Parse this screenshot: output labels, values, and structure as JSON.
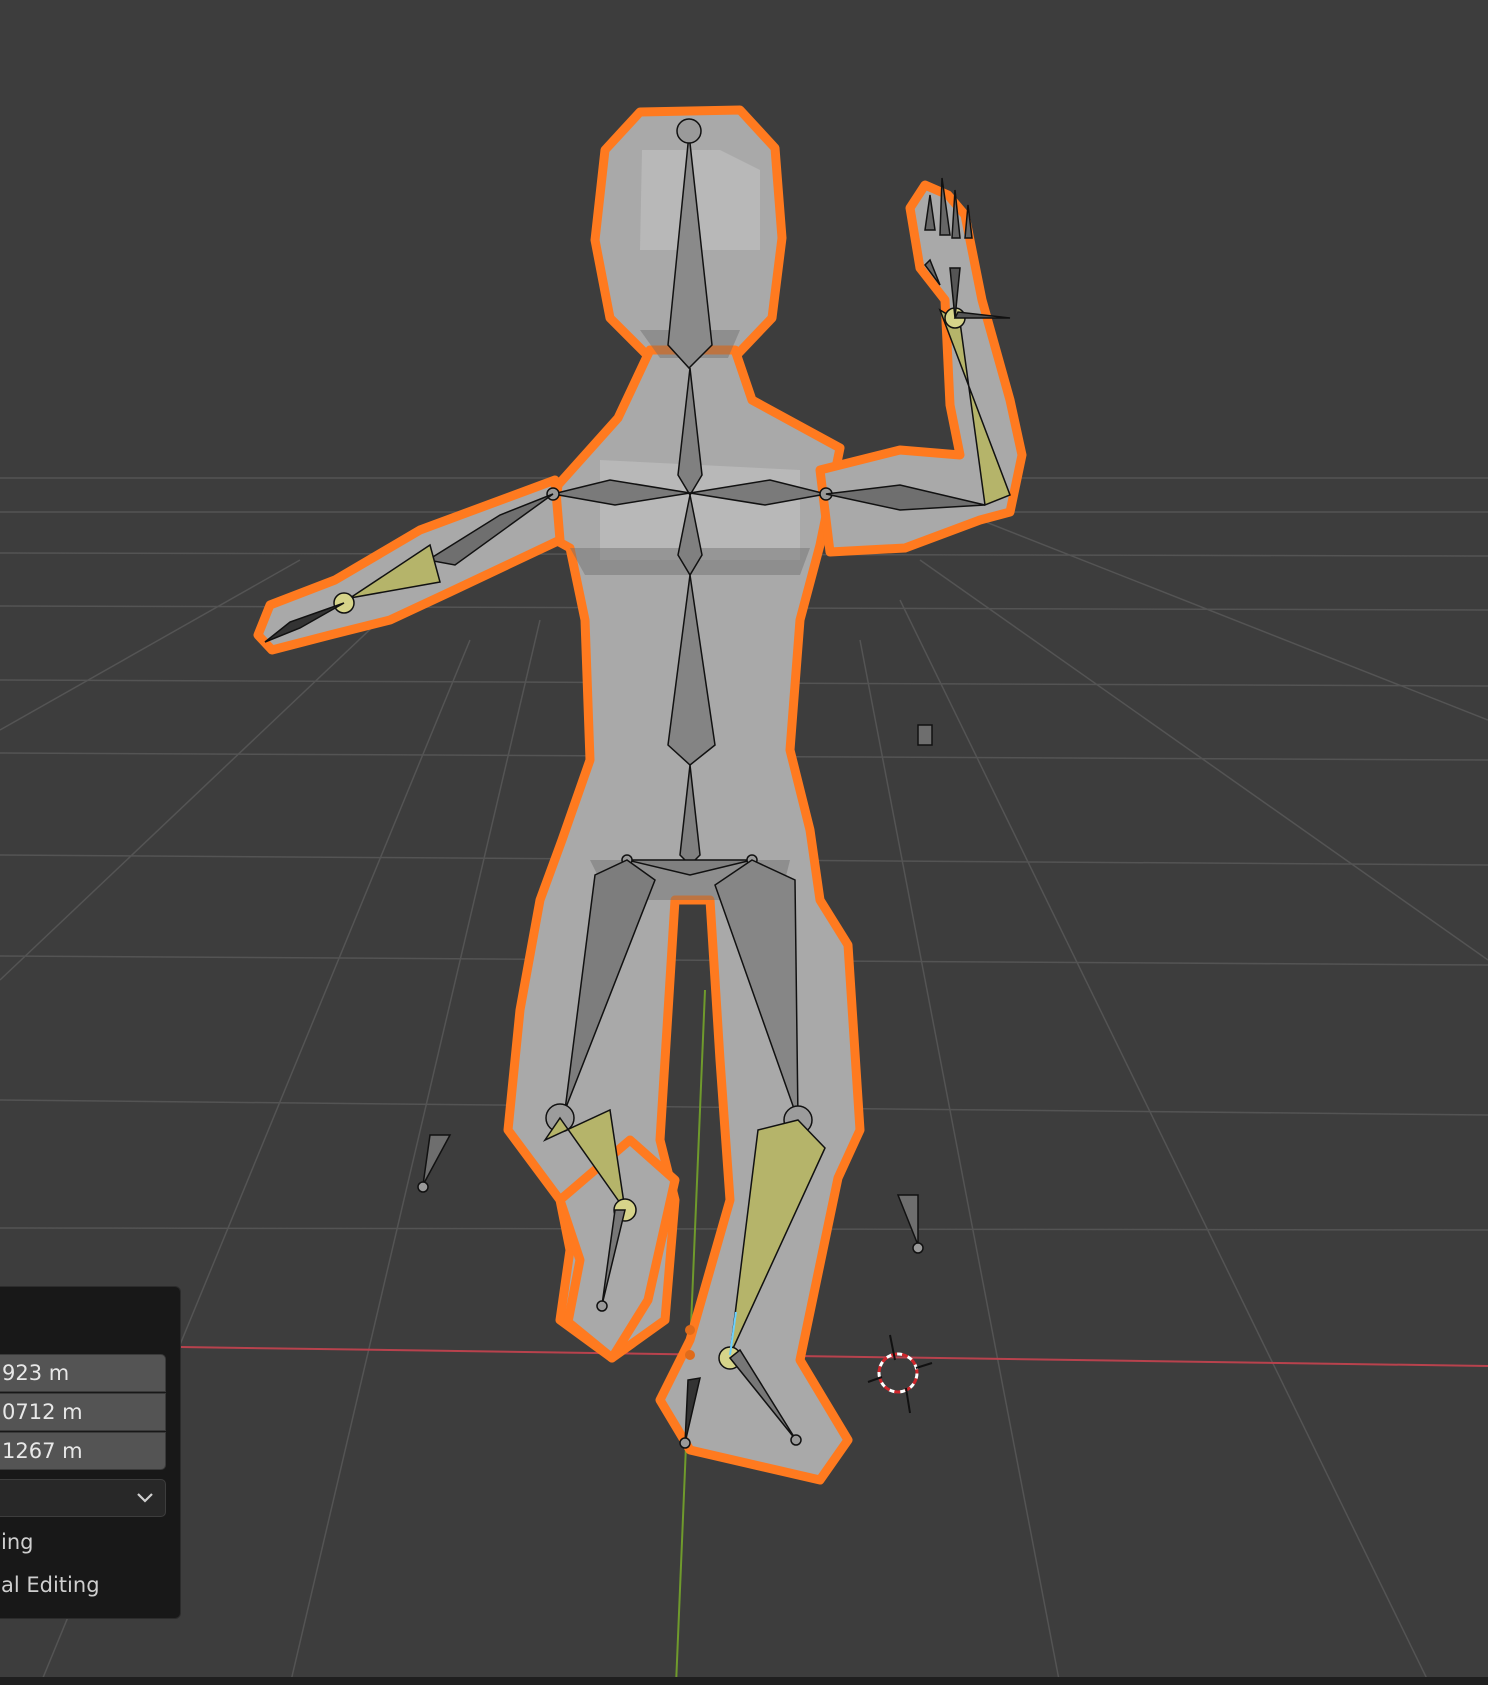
{
  "viewport": {
    "background": "#3d3d3d",
    "grid_color": "#525252",
    "x_axis_color": "#b8424d",
    "y_axis_color": "#6f9a2c",
    "selection_outline_color": "#ff7a1f",
    "mesh_color": "#a8a8a8",
    "bone_color": "#7a7a7a",
    "selected_bone_color": "#b5b46a"
  },
  "operator_panel": {
    "field_x": "923 m",
    "field_y": "0712 m",
    "field_z": "1267 m",
    "option_1": "ing",
    "option_2": "al Editing",
    "dropdown_icon": "chevron-down-icon"
  },
  "scene_icons": {
    "cursor": "3d-cursor-icon",
    "light": "light-icon"
  }
}
